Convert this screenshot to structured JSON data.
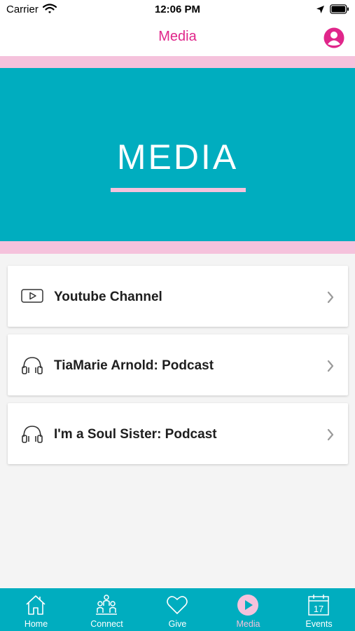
{
  "status_bar": {
    "carrier": "Carrier",
    "time": "12:06 PM"
  },
  "nav": {
    "title": "Media"
  },
  "hero": {
    "title": "MEDIA"
  },
  "media_items": [
    {
      "label": "Youtube Channel",
      "icon": "youtube-play-icon"
    },
    {
      "label": "TiaMarie Arnold: Podcast",
      "icon": "headphones-icon"
    },
    {
      "label": "I'm a Soul Sister: Podcast",
      "icon": "headphones-icon"
    }
  ],
  "tabs": [
    {
      "label": "Home",
      "icon": "home-icon",
      "active": false
    },
    {
      "label": "Connect",
      "icon": "people-icon",
      "active": false
    },
    {
      "label": "Give",
      "icon": "heart-icon",
      "active": false
    },
    {
      "label": "Media",
      "icon": "play-circle-icon",
      "active": true
    },
    {
      "label": "Events",
      "icon": "calendar-icon",
      "active": false,
      "calendar_day": "17"
    }
  ],
  "colors": {
    "brand_teal": "#00adbf",
    "brand_pink": "#e0268a",
    "light_pink": "#f5c2dc"
  }
}
